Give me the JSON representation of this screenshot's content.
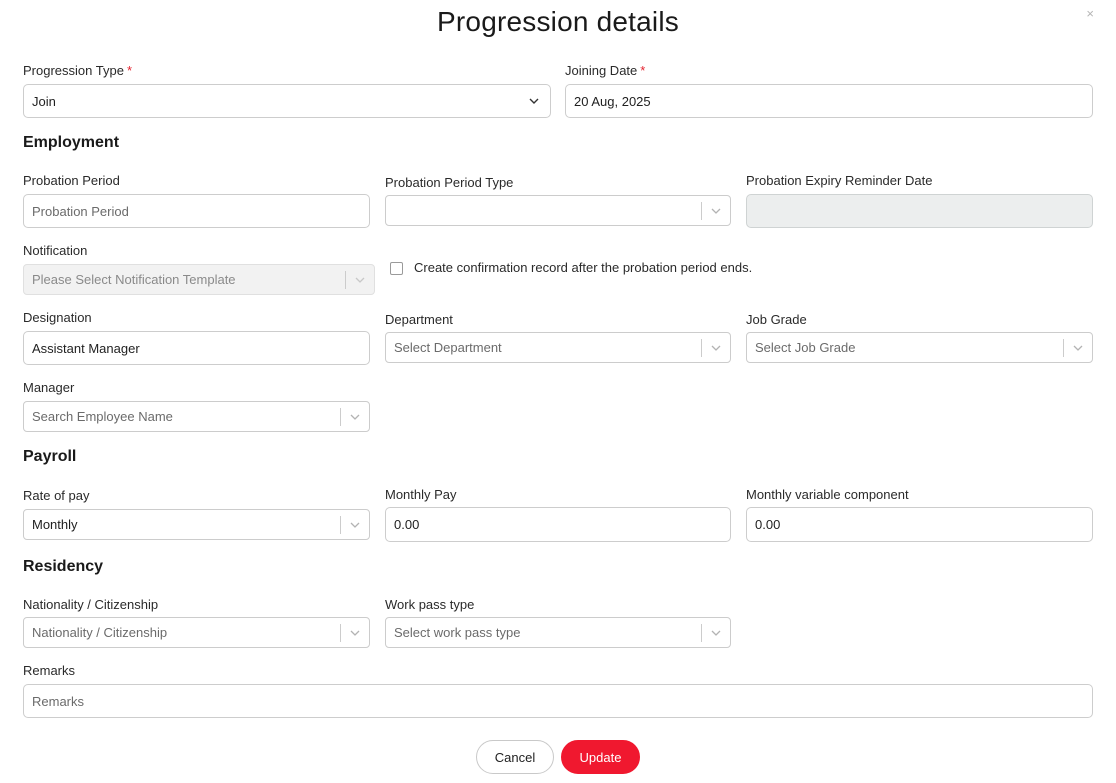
{
  "modal": {
    "title": "Progression details",
    "close": "×"
  },
  "progression_type": {
    "label": "Progression Type",
    "required": "*",
    "value": "Join"
  },
  "joining_date": {
    "label": "Joining Date",
    "required": "*",
    "value": "20 Aug, 2025"
  },
  "sections": {
    "employment": "Employment",
    "payroll": "Payroll",
    "residency": "Residency"
  },
  "employment": {
    "probation_period": {
      "label": "Probation Period",
      "placeholder": "Probation Period"
    },
    "probation_period_type": {
      "label": "Probation Period Type",
      "value": ""
    },
    "probation_expiry": {
      "label": "Probation Expiry Reminder Date",
      "value": ""
    },
    "notification": {
      "label": "Notification",
      "placeholder": "Please Select Notification Template"
    },
    "confirmation_checkbox": {
      "label": "Create confirmation record after the probation period ends.",
      "checked": false
    },
    "designation": {
      "label": "Designation",
      "value": "Assistant Manager"
    },
    "department": {
      "label": "Department",
      "placeholder": "Select Department"
    },
    "job_grade": {
      "label": "Job Grade",
      "placeholder": "Select Job Grade"
    },
    "manager": {
      "label": "Manager",
      "placeholder": "Search Employee Name"
    }
  },
  "payroll": {
    "rate_of_pay": {
      "label": "Rate of pay",
      "value": "Monthly"
    },
    "monthly_pay": {
      "label": "Monthly Pay",
      "value": "0.00"
    },
    "monthly_variable": {
      "label": "Monthly variable component",
      "value": "0.00"
    }
  },
  "residency": {
    "nationality": {
      "label": "Nationality / Citizenship",
      "placeholder": "Nationality / Citizenship"
    },
    "work_pass": {
      "label": "Work pass type",
      "placeholder": "Select work pass type"
    }
  },
  "remarks": {
    "label": "Remarks",
    "placeholder": "Remarks"
  },
  "buttons": {
    "cancel": "Cancel",
    "update": "Update"
  },
  "colors": {
    "primary": "#f0182f",
    "required": "#e4222e",
    "disabled_bg": "#eceeee"
  }
}
